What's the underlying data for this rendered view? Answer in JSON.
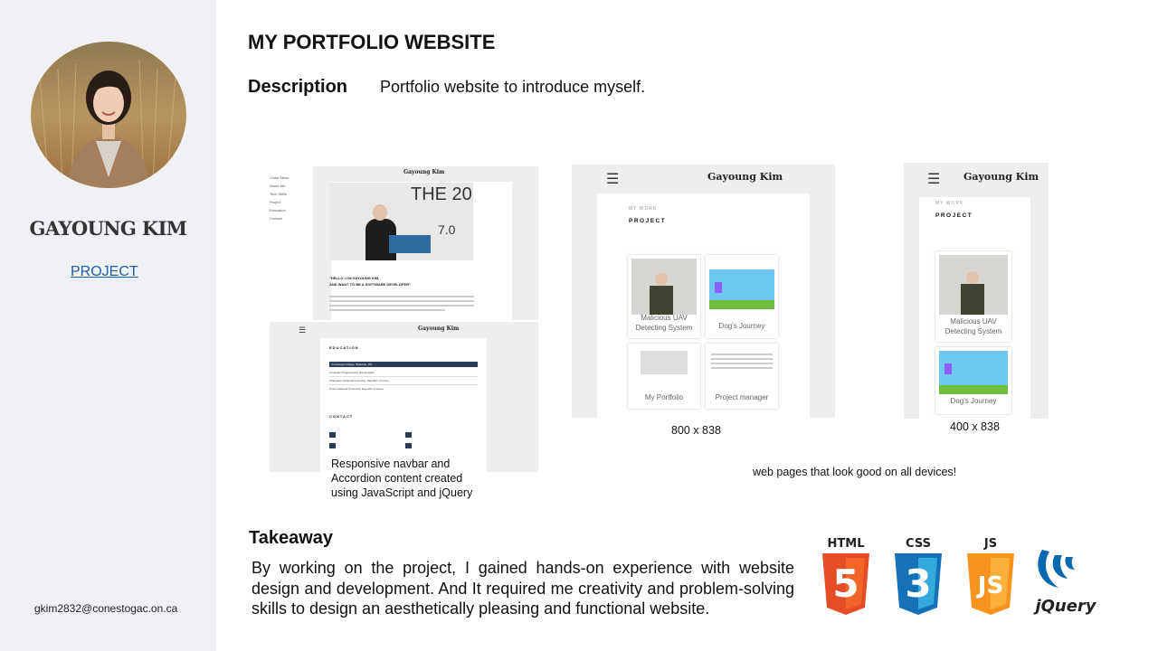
{
  "sidebar": {
    "name": "GAYOUNG KIM",
    "project_link": "PROJECT",
    "email": "gkim2832@conestogac.on.ca"
  },
  "main": {
    "title": "MY PORTFOLIO WEBSITE",
    "description_label": "Description",
    "description_text": "Portfolio website to introduce myself.",
    "caption_left": [
      "Responsive  navbar  and",
      "Accordion content created",
      "using JavaScript  and jQuery"
    ],
    "caption_800": "800 x 838",
    "caption_400": "400 x 838",
    "caption_devices": "web pages that look good on all devices!",
    "takeaway_label": "Takeaway",
    "takeaway_text": "By working on the project, I gained hands-on experience with website design and development. And It required me creativity and problem-solving skills to design an aesthetically pleasing and functional website."
  },
  "mockups": {
    "site_name": "Gayoung Kim",
    "nav_items": [
      "Close Menu",
      "About Me",
      "Tech Skills",
      "Project",
      "Education",
      "Contact"
    ],
    "banner_text": "THE 20",
    "banner_text2": "7.0",
    "hello_lines": [
      "\"HELLO ! I'M GAYOUNG KIM,",
      "AND WANT TO BE A SOFTWARE DEVELOPER\""
    ],
    "education_label": "EDUCATION",
    "education_rows": [
      "Conestoga College, Waterloo, ON",
      "Computer Programming and Analysis",
      "Changwon National University, Republic of Korea",
      "Pusan National University, Republic of Korea"
    ],
    "contact_label": "CONTACT",
    "my_work": "MY WORK",
    "project_heading": "PROJECT",
    "cards": [
      "Malicious UAV Detecting System",
      "Dog's Journey",
      "My Portfolio",
      "Project manager"
    ],
    "card_label_lines": {
      "uav": [
        "Malicious UAV",
        "Detecting System"
      ]
    }
  },
  "tech_icons": [
    {
      "name": "HTML",
      "number": "5",
      "color": "#e44d26"
    },
    {
      "name": "CSS",
      "number": "3",
      "color": "#1572b6"
    },
    {
      "name": "JS",
      "number": "JS",
      "color": "#f7931e"
    },
    {
      "name": "jQuery",
      "color": "#0769ad"
    }
  ]
}
